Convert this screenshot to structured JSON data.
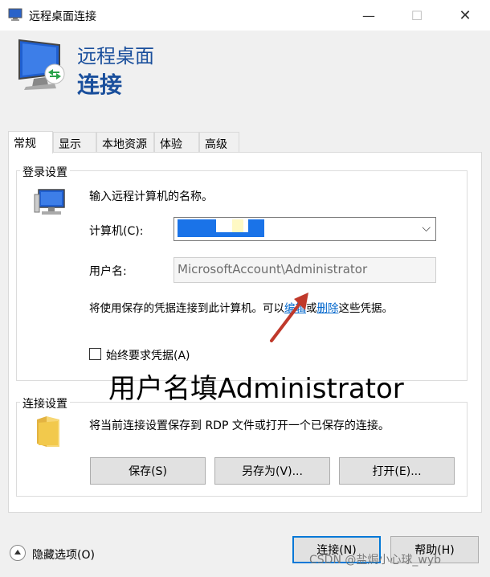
{
  "window": {
    "title": "远程桌面连接"
  },
  "banner": {
    "line1": "远程桌面",
    "line2": "连接"
  },
  "tabs": [
    {
      "label": "常规"
    },
    {
      "label": "显示"
    },
    {
      "label": "本地资源"
    },
    {
      "label": "体验"
    },
    {
      "label": "高级"
    }
  ],
  "login": {
    "group_title": "登录设置",
    "prompt": "输入远程计算机的名称。",
    "computer_label": "计算机(C):",
    "computer_value": "",
    "username_label": "用户名:",
    "username_value": "MicrosoftAccount\\Administrator",
    "saved_text_before": "将使用保存的凭据连接到此计算机。可以",
    "edit_link": "编辑",
    "or_text": "或",
    "delete_link": "删除",
    "saved_text_after": "这些凭据。",
    "always_ask_label": "始终要求凭据(A)"
  },
  "annotation": {
    "text": "用户名填Administrator",
    "color": "#c0392b"
  },
  "connection": {
    "group_title": "连接设置",
    "description": "将当前连接设置保存到 RDP 文件或打开一个已保存的连接。",
    "save": "保存(S)",
    "save_as": "另存为(V)...",
    "open": "打开(E)..."
  },
  "footer": {
    "hide_options": "隐藏选项(O)",
    "connect": "连接(N)",
    "help": "帮助(H)",
    "watermark": "CSDN @盐焗小心球_wyb"
  }
}
